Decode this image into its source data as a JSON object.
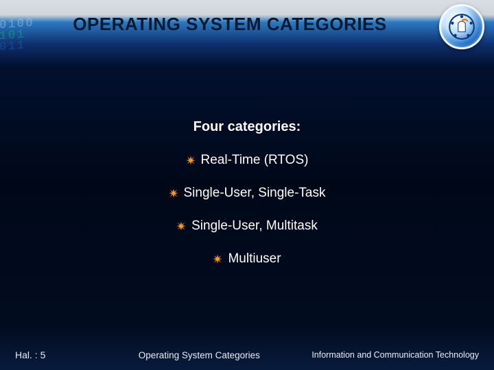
{
  "title": "OPERATING SYSTEM CATEGORIES",
  "subheading": "Four categories:",
  "categories": [
    "Real-Time (RTOS)",
    "Single-User, Single-Task",
    "Single-User, Multitask",
    "Multiuser"
  ],
  "footer": {
    "page": "Hal. : 5",
    "center": "Operating System Categories",
    "right": "Information and Communication Technology"
  },
  "colors": {
    "bullet_fill": "#f69a2b",
    "bullet_stroke": "#b05d00"
  }
}
